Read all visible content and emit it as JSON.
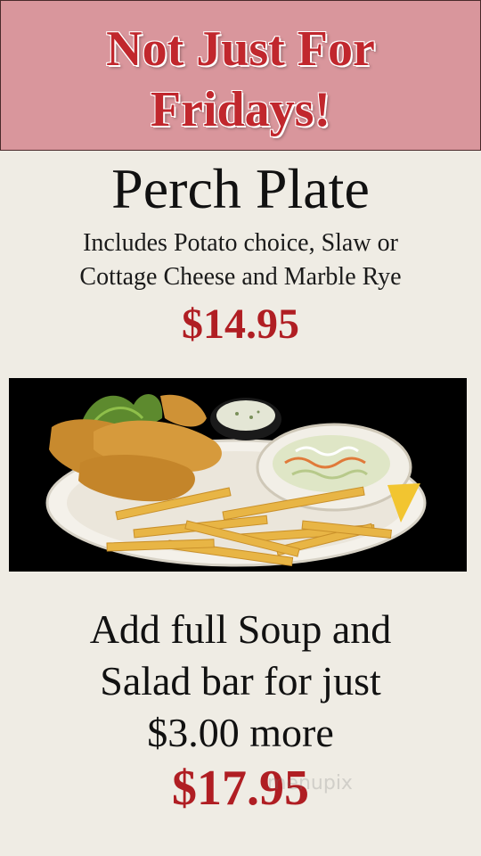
{
  "banner": {
    "line1": "Not Just For",
    "line2": "Fridays!"
  },
  "item": {
    "title": "Perch Plate",
    "description_line1": "Includes  Potato choice, Slaw or",
    "description_line2": "Cottage Cheese and Marble Rye",
    "price": "$14.95"
  },
  "photo": {
    "icon": "fish-plate-photo"
  },
  "addon": {
    "line1": "Add full Soup and",
    "line2": "Salad bar for just",
    "line3": "$3.00 more",
    "price": "$17.95"
  },
  "watermark": {
    "text": "menupix"
  },
  "colors": {
    "banner_bg": "#d9969c",
    "banner_text": "#c1272d",
    "price_text": "#b01e23",
    "page_bg": "#efece4"
  }
}
